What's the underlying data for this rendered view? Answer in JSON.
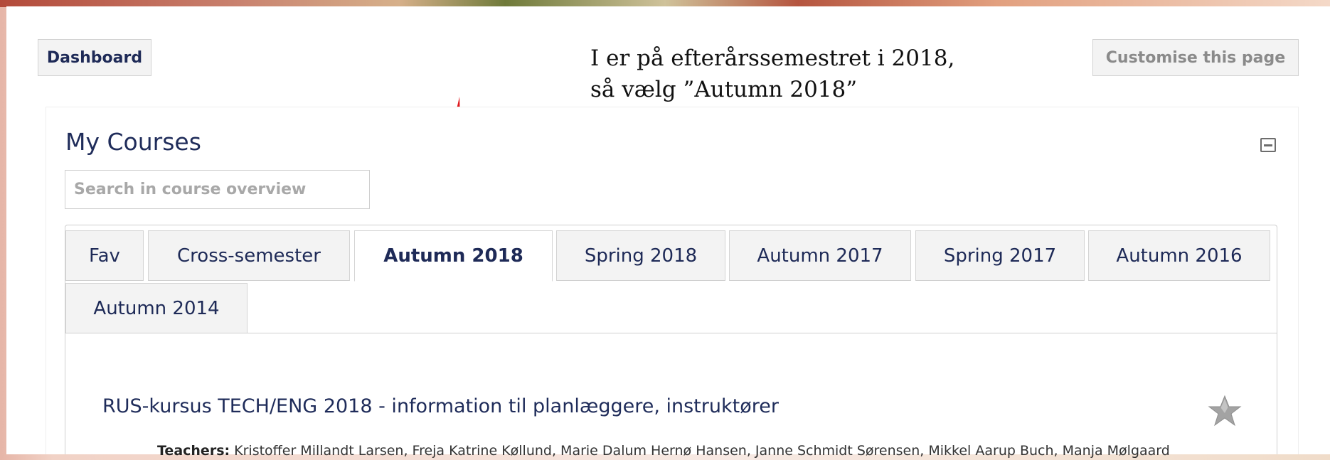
{
  "toolbar": {
    "dashboard_label": "Dashboard",
    "customise_label": "Customise this page"
  },
  "annotation": {
    "line1": "I er på efterårssemestret i 2018,",
    "line2": "så vælg ”Autumn 2018”"
  },
  "block": {
    "title": "My Courses",
    "search_placeholder": "Search in course overview"
  },
  "tabs": [
    {
      "label": "Fav",
      "active": false
    },
    {
      "label": "Cross-semester",
      "active": false
    },
    {
      "label": "Autumn 2018",
      "active": true
    },
    {
      "label": "Spring 2018",
      "active": false
    },
    {
      "label": "Autumn 2017",
      "active": false
    },
    {
      "label": "Spring 2017",
      "active": false
    },
    {
      "label": "Autumn 2016",
      "active": false
    },
    {
      "label": "Autumn 2014",
      "active": false
    }
  ],
  "course": {
    "title": "RUS-kursus TECH/ENG 2018 - information til planlæggere, instruktører",
    "teachers_label": "Teachers:",
    "teachers_value": "Kristoffer Millandt Larsen, Freja Katrine Køllund, Marie Dalum Hernø Hansen, Janne Schmidt Sørensen, Mikkel Aarup Buch, Manja Mølgaard"
  },
  "icons": {
    "collapse": "minus-square-icon",
    "favourite": "star-icon",
    "annotation_arrow": "red-arrow-icon"
  },
  "colors": {
    "heading": "#1f2c5a",
    "arrow": "#e0191e",
    "star": "#9a9a9a"
  }
}
